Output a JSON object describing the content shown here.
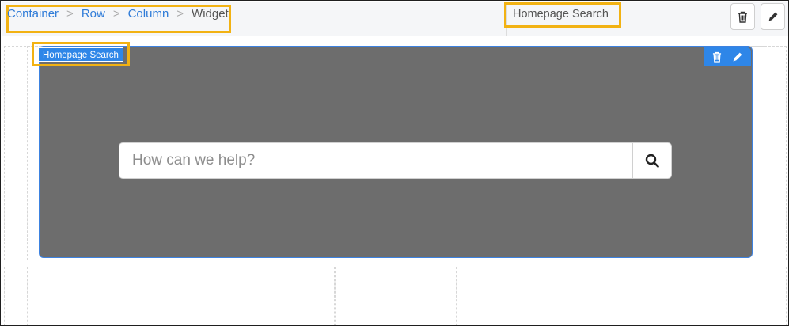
{
  "breadcrumb": {
    "items": [
      "Container",
      "Row",
      "Column"
    ],
    "separator": ">",
    "current": "Widget"
  },
  "header": {
    "widget_title": "Homepage Search",
    "delete_icon": "trash-icon",
    "edit_icon": "pencil-icon"
  },
  "widget": {
    "label": "Homepage Search",
    "background": "#6d6d6d",
    "accent": "#2e86e8",
    "highlight": "#f2b213",
    "search": {
      "placeholder": "How can we help?",
      "button_icon": "search-icon"
    }
  }
}
